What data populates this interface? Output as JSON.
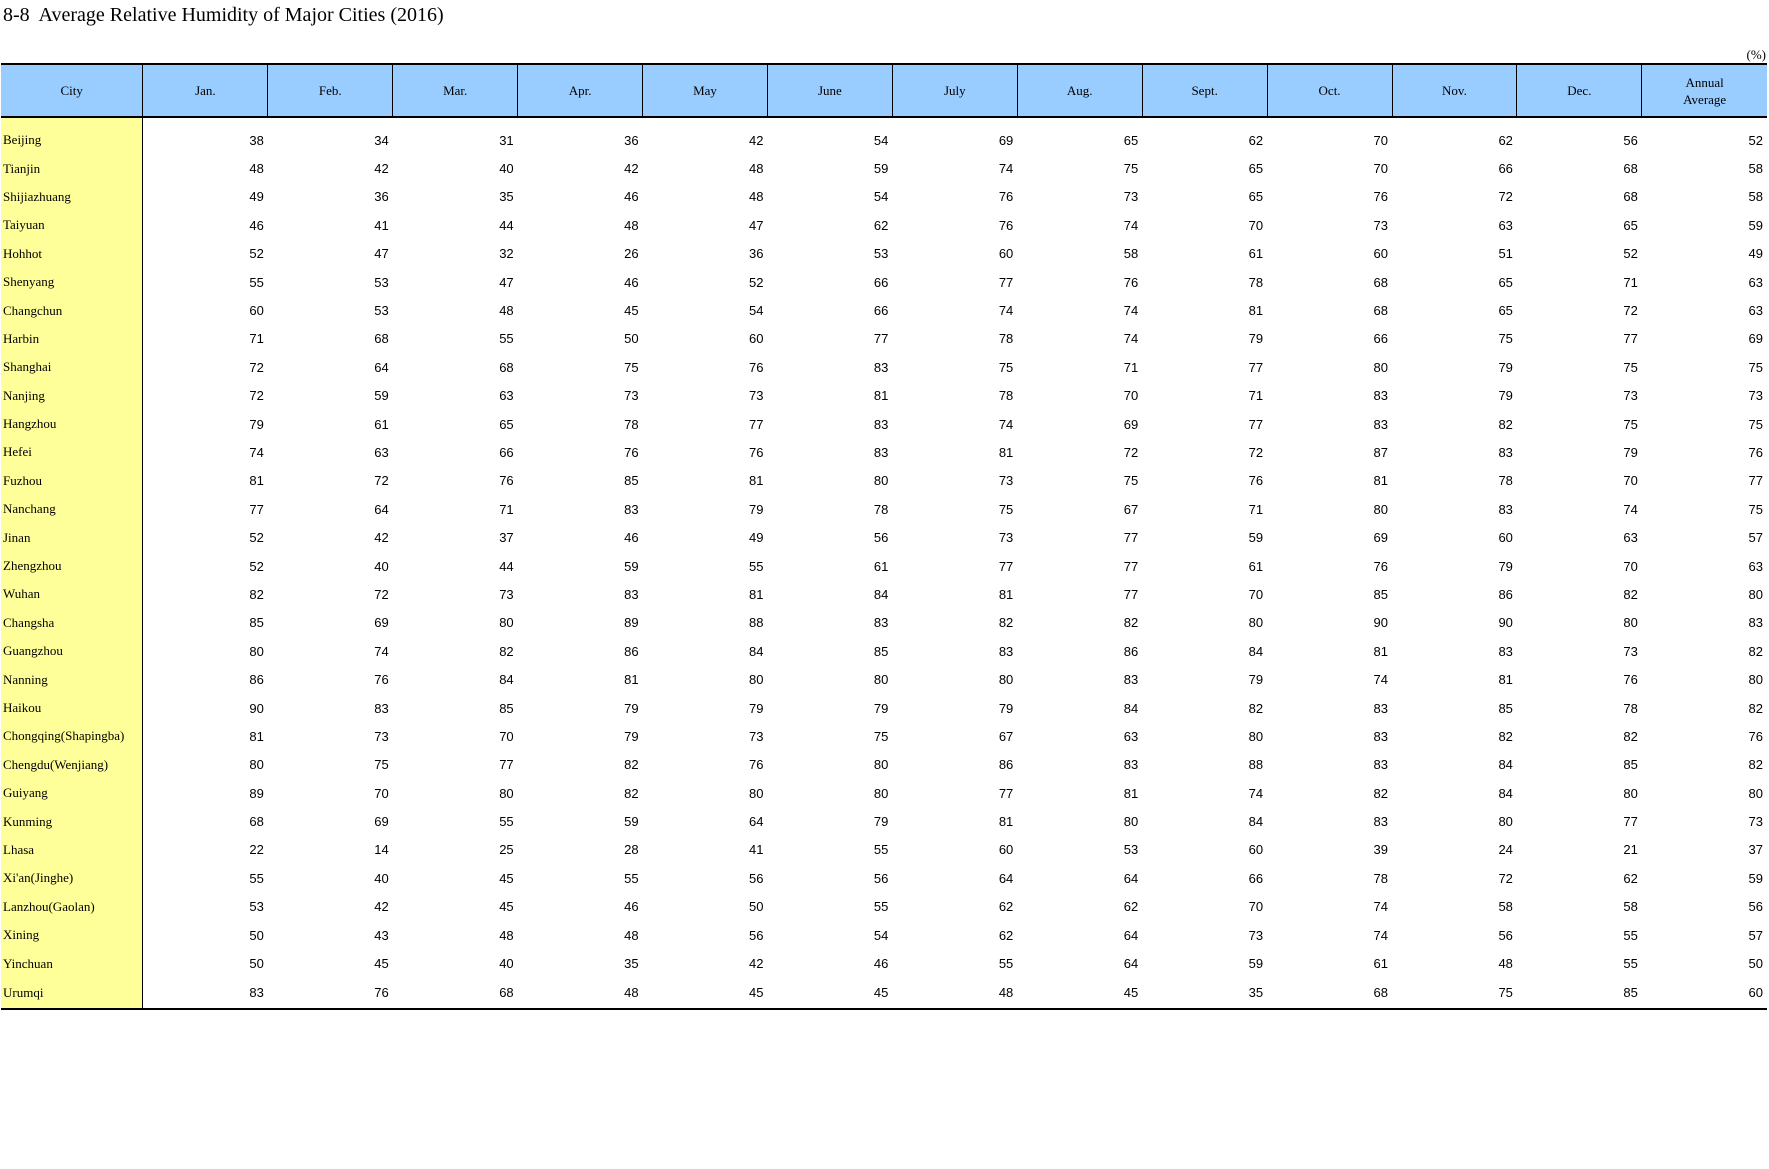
{
  "title": "8-8  Average Relative Humidity of Major Cities (2016)",
  "unit": "(%)",
  "columns": {
    "city": "City",
    "months": [
      "Jan.",
      "Feb.",
      "Mar.",
      "Apr.",
      "May",
      "June",
      "July",
      "Aug.",
      "Sept.",
      "Oct.",
      "Nov.",
      "Dec."
    ],
    "annual_line1": "Annual",
    "annual_line2": "Average"
  },
  "rows": [
    {
      "city": "Beijing",
      "values": [
        38,
        34,
        31,
        36,
        42,
        54,
        69,
        65,
        62,
        70,
        62,
        56,
        52
      ]
    },
    {
      "city": "Tianjin",
      "values": [
        48,
        42,
        40,
        42,
        48,
        59,
        74,
        75,
        65,
        70,
        66,
        68,
        58
      ]
    },
    {
      "city": "Shijiazhuang",
      "values": [
        49,
        36,
        35,
        46,
        48,
        54,
        76,
        73,
        65,
        76,
        72,
        68,
        58
      ]
    },
    {
      "city": "Taiyuan",
      "values": [
        46,
        41,
        44,
        48,
        47,
        62,
        76,
        74,
        70,
        73,
        63,
        65,
        59
      ]
    },
    {
      "city": "Hohhot",
      "values": [
        52,
        47,
        32,
        26,
        36,
        53,
        60,
        58,
        61,
        60,
        51,
        52,
        49
      ]
    },
    {
      "city": "Shenyang",
      "values": [
        55,
        53,
        47,
        46,
        52,
        66,
        77,
        76,
        78,
        68,
        65,
        71,
        63
      ]
    },
    {
      "city": "Changchun",
      "values": [
        60,
        53,
        48,
        45,
        54,
        66,
        74,
        74,
        81,
        68,
        65,
        72,
        63
      ]
    },
    {
      "city": "Harbin",
      "values": [
        71,
        68,
        55,
        50,
        60,
        77,
        78,
        74,
        79,
        66,
        75,
        77,
        69
      ]
    },
    {
      "city": "Shanghai",
      "values": [
        72,
        64,
        68,
        75,
        76,
        83,
        75,
        71,
        77,
        80,
        79,
        75,
        75
      ]
    },
    {
      "city": "Nanjing",
      "values": [
        72,
        59,
        63,
        73,
        73,
        81,
        78,
        70,
        71,
        83,
        79,
        73,
        73
      ]
    },
    {
      "city": "Hangzhou",
      "values": [
        79,
        61,
        65,
        78,
        77,
        83,
        74,
        69,
        77,
        83,
        82,
        75,
        75
      ]
    },
    {
      "city": "Hefei",
      "values": [
        74,
        63,
        66,
        76,
        76,
        83,
        81,
        72,
        72,
        87,
        83,
        79,
        76
      ]
    },
    {
      "city": "Fuzhou",
      "values": [
        81,
        72,
        76,
        85,
        81,
        80,
        73,
        75,
        76,
        81,
        78,
        70,
        77
      ]
    },
    {
      "city": "Nanchang",
      "values": [
        77,
        64,
        71,
        83,
        79,
        78,
        75,
        67,
        71,
        80,
        83,
        74,
        75
      ]
    },
    {
      "city": "Jinan",
      "values": [
        52,
        42,
        37,
        46,
        49,
        56,
        73,
        77,
        59,
        69,
        60,
        63,
        57
      ]
    },
    {
      "city": "Zhengzhou",
      "values": [
        52,
        40,
        44,
        59,
        55,
        61,
        77,
        77,
        61,
        76,
        79,
        70,
        63
      ]
    },
    {
      "city": "Wuhan",
      "values": [
        82,
        72,
        73,
        83,
        81,
        84,
        81,
        77,
        70,
        85,
        86,
        82,
        80
      ]
    },
    {
      "city": "Changsha",
      "values": [
        85,
        69,
        80,
        89,
        88,
        83,
        82,
        82,
        80,
        90,
        90,
        80,
        83
      ]
    },
    {
      "city": "Guangzhou",
      "values": [
        80,
        74,
        82,
        86,
        84,
        85,
        83,
        86,
        84,
        81,
        83,
        73,
        82
      ]
    },
    {
      "city": "Nanning",
      "values": [
        86,
        76,
        84,
        81,
        80,
        80,
        80,
        83,
        79,
        74,
        81,
        76,
        80
      ]
    },
    {
      "city": "Haikou",
      "values": [
        90,
        83,
        85,
        79,
        79,
        79,
        79,
        84,
        82,
        83,
        85,
        78,
        82
      ]
    },
    {
      "city": "Chongqing(Shapingba)",
      "values": [
        81,
        73,
        70,
        79,
        73,
        75,
        67,
        63,
        80,
        83,
        82,
        82,
        76
      ]
    },
    {
      "city": "Chengdu(Wenjiang)",
      "values": [
        80,
        75,
        77,
        82,
        76,
        80,
        86,
        83,
        88,
        83,
        84,
        85,
        82
      ]
    },
    {
      "city": "Guiyang",
      "values": [
        89,
        70,
        80,
        82,
        80,
        80,
        77,
        81,
        74,
        82,
        84,
        80,
        80
      ]
    },
    {
      "city": "Kunming",
      "values": [
        68,
        69,
        55,
        59,
        64,
        79,
        81,
        80,
        84,
        83,
        80,
        77,
        73
      ]
    },
    {
      "city": "Lhasa",
      "values": [
        22,
        14,
        25,
        28,
        41,
        55,
        60,
        53,
        60,
        39,
        24,
        21,
        37
      ]
    },
    {
      "city": "Xi'an(Jinghe)",
      "values": [
        55,
        40,
        45,
        55,
        56,
        56,
        64,
        64,
        66,
        78,
        72,
        62,
        59
      ]
    },
    {
      "city": "Lanzhou(Gaolan)",
      "values": [
        53,
        42,
        45,
        46,
        50,
        55,
        62,
        62,
        70,
        74,
        58,
        58,
        56
      ]
    },
    {
      "city": "Xining",
      "values": [
        50,
        43,
        48,
        48,
        56,
        54,
        62,
        64,
        73,
        74,
        56,
        55,
        57
      ]
    },
    {
      "city": "Yinchuan",
      "values": [
        50,
        45,
        40,
        35,
        42,
        46,
        55,
        64,
        59,
        61,
        48,
        55,
        50
      ]
    },
    {
      "city": "Urumqi",
      "values": [
        83,
        76,
        68,
        48,
        45,
        45,
        48,
        45,
        35,
        68,
        75,
        85,
        60
      ]
    }
  ]
}
